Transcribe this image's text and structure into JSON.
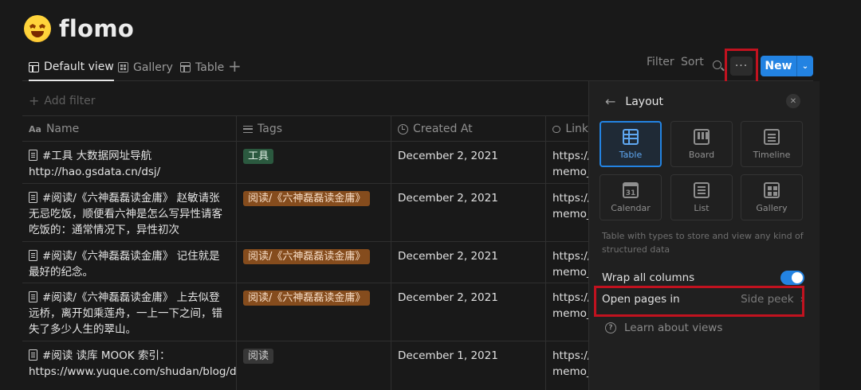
{
  "page": {
    "title": "flomo",
    "emoji_icon": "star-struck-emoji-icon"
  },
  "views": {
    "tabs": [
      {
        "label": "Default view",
        "icon": "table-icon",
        "active": true
      },
      {
        "label": "Gallery",
        "icon": "gallery-icon",
        "active": false
      },
      {
        "label": "Table",
        "icon": "table-icon",
        "active": false
      }
    ],
    "add_symbol": "+"
  },
  "toolbar": {
    "filter_label": "Filter",
    "sort_label": "Sort",
    "more_symbol": "···",
    "new_label": "New",
    "new_caret": "⌄"
  },
  "filter_bar": {
    "add_filter_label": "Add filter",
    "plus": "+"
  },
  "table": {
    "columns": [
      {
        "label": "Name",
        "icon": "Aa"
      },
      {
        "label": "Tags",
        "icon": "list-icon"
      },
      {
        "label": "Created At",
        "icon": "clock-icon"
      },
      {
        "label": "Link",
        "icon": "link-icon"
      }
    ],
    "rows": [
      {
        "name_lines": [
          "#工具 大数据网址导航",
          "http://hao.gsdata.cn/dsj/"
        ],
        "tag": "工具",
        "tag_color": "#2b593f",
        "created": "December 2, 2021",
        "link_lines": [
          "https://",
          "memo_"
        ]
      },
      {
        "name_lines": [
          "#阅读/《六神磊磊读金庸》 赵敏请张",
          "无忌吃饭，顺便看六神是怎么写异性请客",
          "吃饭的：通常情况下，异性初次"
        ],
        "tag": "阅读/《六神磊磊读金庸》",
        "tag_color": "#854c1d",
        "created": "December 2, 2021",
        "link_lines": [
          "https://",
          "memo_"
        ]
      },
      {
        "name_lines": [
          "#阅读/《六神磊磊读金庸》 记住就是",
          "最好的纪念。"
        ],
        "tag": "阅读/《六神磊磊读金庸》",
        "tag_color": "#854c1d",
        "created": "December 2, 2021",
        "link_lines": [
          "https://",
          "memo_"
        ]
      },
      {
        "name_lines": [
          "#阅读/《六神磊磊读金庸》 上去似登",
          "远桥，离开如乘莲舟，一上一下之间，错",
          "失了多少人生的翠山。"
        ],
        "tag": "阅读/《六神磊磊读金庸》",
        "tag_color": "#854c1d",
        "created": "December 2, 2021",
        "link_lines": [
          "https://",
          "memo_"
        ]
      },
      {
        "name_lines": [
          "#阅读 读库 MOOK 索引：",
          "https://www.yuque.com/shudan/blog/d"
        ],
        "tag": "阅读",
        "tag_color": "#373737",
        "created": "December 1, 2021",
        "link_lines": [
          "https://",
          "memo_"
        ]
      }
    ]
  },
  "layout_panel": {
    "title": "Layout",
    "back_symbol": "←",
    "close_symbol": "✕",
    "options": [
      {
        "label": "Table",
        "icon": "table-icon",
        "selected": true
      },
      {
        "label": "Board",
        "icon": "board-icon",
        "selected": false
      },
      {
        "label": "Timeline",
        "icon": "timeline-icon",
        "selected": false
      },
      {
        "label": "Calendar",
        "icon": "calendar-icon",
        "selected": false
      },
      {
        "label": "List",
        "icon": "list-icon",
        "selected": false
      },
      {
        "label": "Gallery",
        "icon": "gallery-icon",
        "selected": false
      }
    ],
    "description": "Table with types to store and view any kind of structured data",
    "wrap_label": "Wrap all columns",
    "wrap_on": true,
    "open_pages_label": "Open pages in",
    "open_pages_value": "Side peek",
    "chevron": "›",
    "learn_label": "Learn about views",
    "help_symbol": "?"
  },
  "colors": {
    "accent": "#2383e2",
    "highlight_box": "#c1121f",
    "background": "#191919",
    "panel": "#202020"
  }
}
